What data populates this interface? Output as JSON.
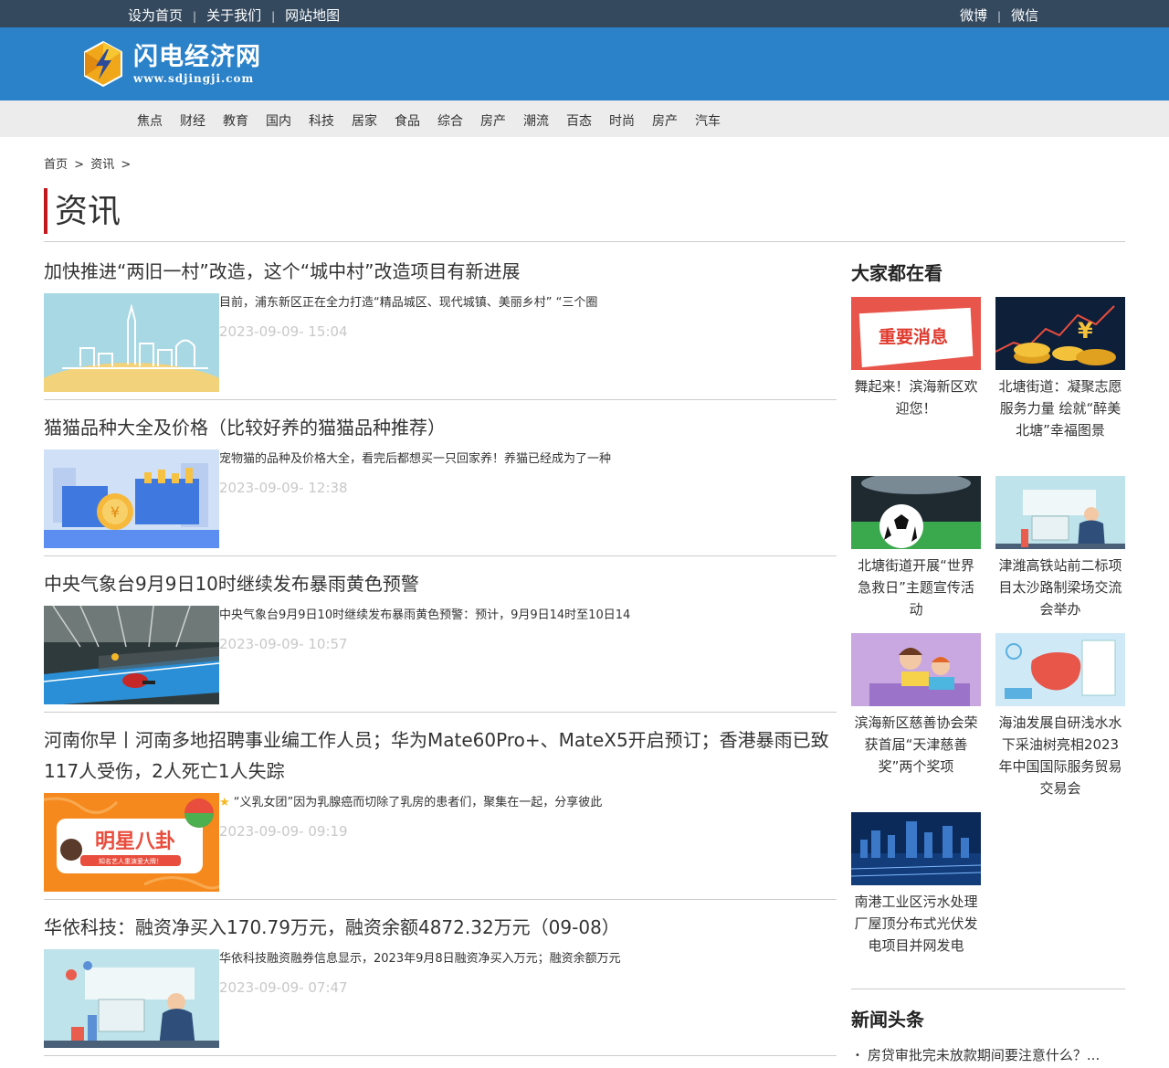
{
  "topbar": {
    "left_links": [
      "设为首页",
      "关于我们",
      "网站地图"
    ],
    "right_links": [
      "微博",
      "微信"
    ],
    "separator": "|"
  },
  "header": {
    "site_name": "闪电经济网",
    "site_url": "www.sdjingji.com"
  },
  "nav": [
    "焦点",
    "财经",
    "教育",
    "国内",
    "科技",
    "居家",
    "食品",
    "综合",
    "房产",
    "潮流",
    "百态",
    "时尚",
    "房产",
    "汽车"
  ],
  "breadcrumb": {
    "home": "首页",
    "sep": ">",
    "current": "资讯",
    "trail": ">"
  },
  "page_title": "资讯",
  "articles": [
    {
      "title": "加快推进“两旧一村”改造，这个“城中村”改造项目有新进展",
      "summary": "目前，浦东新区正在全力打造“精品城区、现代城镇、美丽乡村” “三个圈",
      "date": "2023-09-09- 15:04"
    },
    {
      "title": "猫猫品种大全及价格（比较好养的猫猫品种推荐）",
      "summary": "宠物猫的品种及价格大全，看完后都想买一只回家养！养猫已经成为了一种",
      "date": "2023-09-09- 12:38"
    },
    {
      "title": "中央气象台9月9日10时继续发布暴雨黄色预警",
      "summary": "中央气象台9月9日10时继续发布暴雨黄色预警：预计，9月9日14时至10日14",
      "date": "2023-09-09- 10:57"
    },
    {
      "title": "河南你早丨河南多地招聘事业编工作人员；华为Mate60Pro+、MateX5开启预订；香港暴雨已致117人受伤，2人死亡1人失踪",
      "summary": "“义乳女团”因为乳腺癌而切除了乳房的患者们，聚集在一起，分享彼此",
      "date": "2023-09-09- 09:19",
      "thumb_text": "明星八卦",
      "thumb_subtext": "知名艺人重演爱大牌！"
    },
    {
      "title": "华依科技：融资净买入170.79万元，融资余额4872.32万元（09-08）",
      "summary": "华依科技融资融券信息显示，2023年9月8日融资净买入万元；融资余额万元",
      "date": "2023-09-09- 07:47"
    }
  ],
  "sidebar": {
    "popular_heading": "大家都在看",
    "popular": [
      {
        "caption": "舞起来！滨海新区欢迎您！",
        "img_text": "重要消息"
      },
      {
        "caption": "北塘街道：凝聚志愿服务力量 绘就“醉美北塘”幸福图景"
      },
      {
        "caption": "北塘街道开展“世界急救日”主题宣传活动"
      },
      {
        "caption": "津潍高铁站前二标项目太沙路制梁场交流会举办"
      },
      {
        "caption": "滨海新区慈善协会荣获首届“天津慈善奖”两个奖项"
      },
      {
        "caption": "海油发展自研浅水水下采油树亮相2023年中国国际服务贸易交易会"
      },
      {
        "caption": "南港工业区污水处理厂屋顶分布式光伏发电项目并网发电"
      }
    ],
    "news_heading": "新闻头条",
    "news": [
      "房贷审批完未放款期间要注意什么？..."
    ]
  },
  "colors": {
    "topbar_bg": "#34495e",
    "header_bg": "#2b82c9",
    "nav_bg": "#ececec",
    "title_accent": "#c0181f",
    "date_text": "#c8c8c8"
  }
}
